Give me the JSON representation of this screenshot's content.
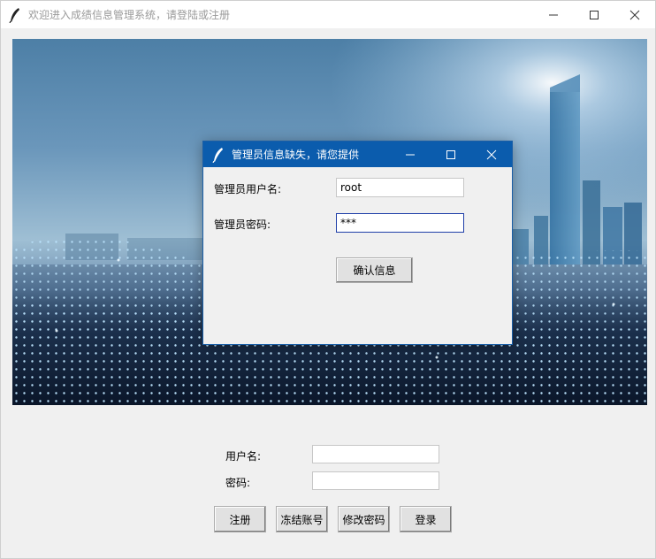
{
  "main_window": {
    "title": "欢迎进入成绩信息管理系统，请登陆或注册",
    "icons": {
      "app": "feather-icon",
      "minimize": "minimize-icon",
      "maximize": "maximize-icon",
      "close": "close-icon"
    }
  },
  "login_form": {
    "username_label": "用户名:",
    "username_value": "",
    "password_label": "密码:",
    "password_value": "",
    "buttons": {
      "register": "注册",
      "freeze": "冻结账号",
      "change_password": "修改密码",
      "login": "登录"
    }
  },
  "dialog": {
    "title": "管理员信息缺失，请您提供",
    "admin_username_label": "管理员用户名:",
    "admin_username_value": "root",
    "admin_password_label": "管理员密码:",
    "admin_password_value": "***",
    "confirm_button": "确认信息"
  },
  "colors": {
    "dialog_titlebar": "#0b5cad",
    "window_bg": "#f0f0f0",
    "focus_border": "#1f3fa8"
  }
}
